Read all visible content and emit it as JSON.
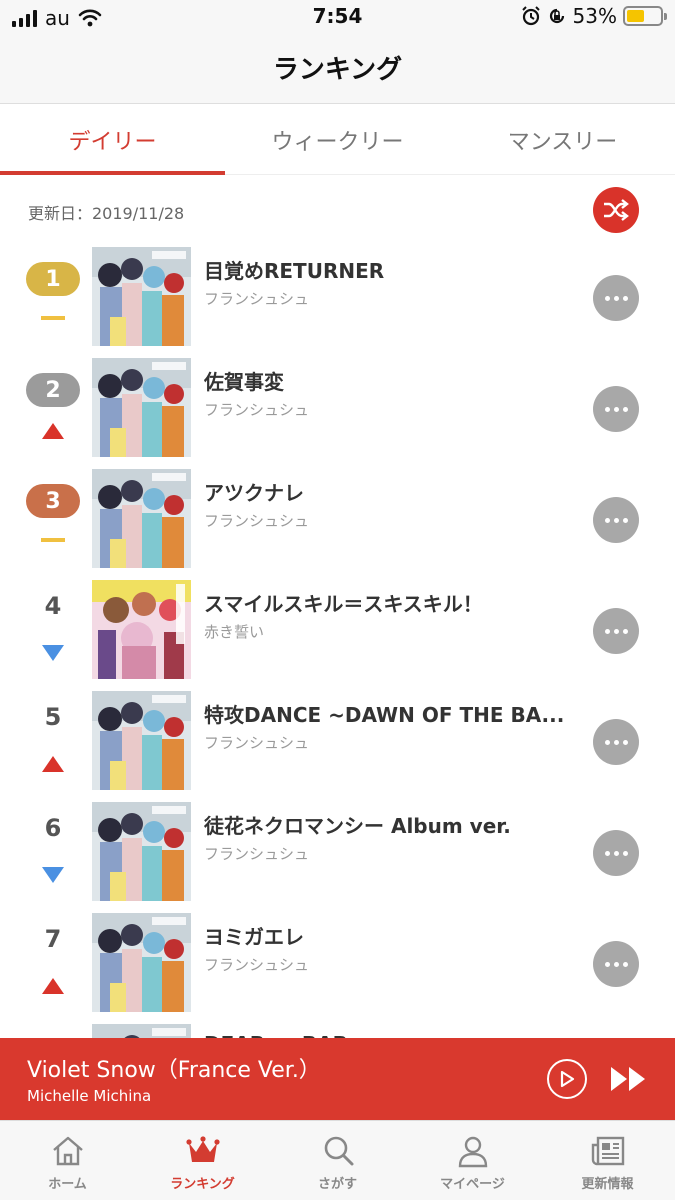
{
  "status_bar": {
    "carrier": "au",
    "time": "7:54",
    "battery_percent": "53%",
    "battery_level": 0.53,
    "icons": [
      "signal-icon",
      "wifi-icon",
      "alarm-icon",
      "orientation-lock-icon",
      "battery-icon"
    ]
  },
  "header": {
    "title": "ランキング"
  },
  "tabs": [
    {
      "label": "デイリー",
      "active": true
    },
    {
      "label": "ウィークリー",
      "active": false
    },
    {
      "label": "マンスリー",
      "active": false
    }
  ],
  "updated_text": "更新日：2019/11/28",
  "shuffle_icon": "shuffle-icon",
  "colors": {
    "accent": "#d9392e",
    "gold": "#d8b547",
    "silver": "#9b9b9b",
    "bronze": "#c9704a",
    "trend_up": "#d9332a",
    "trend_down": "#4a90e2",
    "trend_same": "#f0c040"
  },
  "ranking": [
    {
      "rank": "1",
      "badge": "gold",
      "trend": "same",
      "title": "目覚めRETURNER",
      "artist": "フランシュシュ",
      "art": "zombieland"
    },
    {
      "rank": "2",
      "badge": "silver",
      "trend": "up",
      "title": "佐賀事変",
      "artist": "フランシュシュ",
      "art": "zombieland"
    },
    {
      "rank": "3",
      "badge": "bronze",
      "trend": "same",
      "title": "アツクナレ",
      "artist": "フランシュシュ",
      "art": "zombieland"
    },
    {
      "rank": "4",
      "badge": "",
      "trend": "down",
      "title": "スマイルスキル＝スキスキル！",
      "artist": "赤き誓い",
      "art": "pink"
    },
    {
      "rank": "5",
      "badge": "",
      "trend": "up",
      "title": "特攻DANCE ~DAWN OF THE BA...",
      "artist": "フランシュシュ",
      "art": "zombieland"
    },
    {
      "rank": "6",
      "badge": "",
      "trend": "down",
      "title": "徒花ネクロマンシー Album ver.",
      "artist": "フランシュシュ",
      "art": "zombieland"
    },
    {
      "rank": "7",
      "badge": "",
      "trend": "up",
      "title": "ヨミガエレ",
      "artist": "フランシュシュ",
      "art": "zombieland"
    },
    {
      "rank": "",
      "badge": "",
      "trend": "",
      "title": "DEAR ... BAB...",
      "artist": "",
      "art": "zombieland"
    }
  ],
  "player": {
    "title": "Violet Snow（France Ver.）",
    "artist": "Michelle Michina",
    "play_icon": "play-icon",
    "fast_forward_icon": "fast-forward-icon"
  },
  "bottom_nav": [
    {
      "label": "ホーム",
      "icon": "home-icon",
      "active": false
    },
    {
      "label": "ランキング",
      "icon": "crown-icon",
      "active": true
    },
    {
      "label": "さがす",
      "icon": "search-icon",
      "active": false
    },
    {
      "label": "マイページ",
      "icon": "user-icon",
      "active": false
    },
    {
      "label": "更新情報",
      "icon": "news-icon",
      "active": false
    }
  ]
}
